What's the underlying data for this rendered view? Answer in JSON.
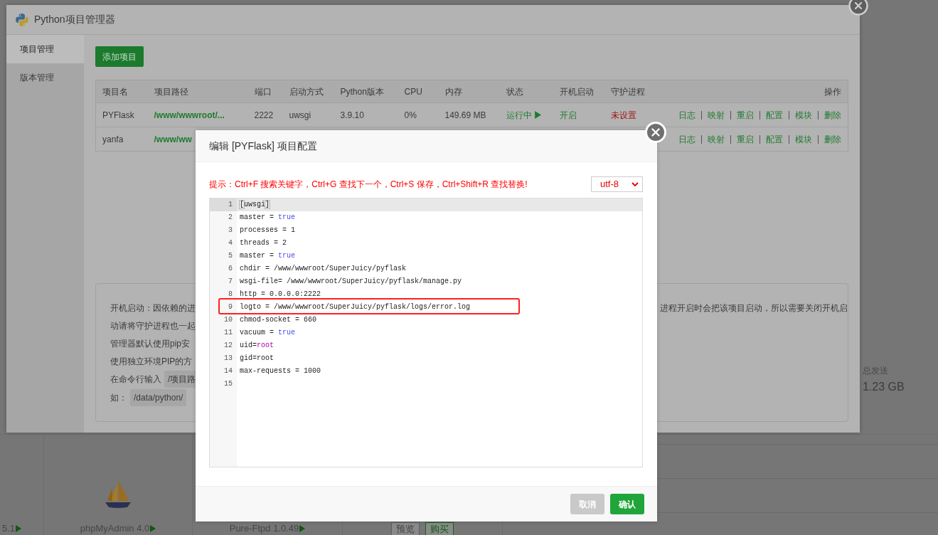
{
  "background_page": {
    "stats": {
      "label": "总发送",
      "value": "1.23 GB"
    },
    "tiles": [
      {
        "kind": "label",
        "label": "5.1"
      },
      {
        "kind": "logo",
        "label": "phpMyAdmin 4.0"
      },
      {
        "kind": "label",
        "label": "Pure-Ftpd 1.0.49"
      },
      {
        "kind": "buttons",
        "buttons": [
          {
            "label": "预览",
            "kind": "preview"
          },
          {
            "label": "购买",
            "kind": "buy"
          }
        ]
      }
    ]
  },
  "manager_window": {
    "title": "Python项目管理器",
    "sidebar": [
      {
        "label": "项目管理",
        "selected": true
      },
      {
        "label": "版本管理",
        "selected": false
      }
    ],
    "add_button": "添加项目",
    "table": {
      "columns": [
        "项目名",
        "项目路径",
        "端口",
        "启动方式",
        "Python版本",
        "CPU",
        "内存",
        "状态",
        "开机启动",
        "守护进程",
        "操作"
      ],
      "rows": [
        {
          "name": "PYFlask",
          "path": "/www/wwwroot/...",
          "port": "2222",
          "start_mode": "uwsgi",
          "python_version": "3.9.10",
          "cpu": "0%",
          "memory": "149.69 MB",
          "status": {
            "text": "运行中",
            "running": true
          },
          "autostart": {
            "text": "开启",
            "on": true
          },
          "daemon": {
            "text": "未设置",
            "configured": false
          },
          "actions": [
            "日志",
            "映射",
            "重启",
            "配置",
            "模块",
            "删除"
          ]
        },
        {
          "name": "yanfa",
          "path": "/www/ww",
          "actions": [
            "日志",
            "映射",
            "重启",
            "配置",
            "模块",
            "删除"
          ]
        }
      ]
    },
    "notes": [
      {
        "left": "开机启动：因依赖的进",
        "right": "进程开启时会把该项目启动，所以需要关闭开机启"
      },
      {
        "left": "动请将守护进程也一起"
      },
      {
        "left": "管理器默认使用pip安"
      },
      {
        "left": "使用独立环境PIP的方"
      },
      {
        "left": "在命令行输入",
        "code": "/项目路"
      },
      {
        "left": "如：",
        "code": "/data/python/"
      }
    ]
  },
  "editor_dialog": {
    "title": "编辑 [PYFlask] 项目配置",
    "hint": "提示：Ctrl+F 搜索关键字，Ctrl+G 查找下一个，Ctrl+S 保存，Ctrl+Shift+R 查找替换!",
    "encoding": "utf-8",
    "lines": [
      {
        "number": "1",
        "active": true,
        "annotated": false,
        "segments": [
          {
            "text": "[",
            "kind": "matched-bracket"
          },
          {
            "text": "uwsgi",
            "kind": "plain"
          },
          {
            "text": "]",
            "kind": "matched-bracket"
          }
        ]
      },
      {
        "number": "2",
        "active": false,
        "annotated": false,
        "segments": [
          {
            "text": "master = ",
            "kind": "plain"
          },
          {
            "text": "true",
            "kind": "atom"
          }
        ]
      },
      {
        "number": "3",
        "active": false,
        "annotated": false,
        "segments": [
          {
            "text": "processes = 1",
            "kind": "plain"
          }
        ]
      },
      {
        "number": "4",
        "active": false,
        "annotated": false,
        "segments": [
          {
            "text": "threads = 2",
            "kind": "plain"
          }
        ]
      },
      {
        "number": "5",
        "active": false,
        "annotated": false,
        "segments": [
          {
            "text": "master = ",
            "kind": "plain"
          },
          {
            "text": "true",
            "kind": "atom"
          }
        ]
      },
      {
        "number": "6",
        "active": false,
        "annotated": false,
        "segments": [
          {
            "text": "chdir = /www/wwwroot/SuperJuicy/pyflask",
            "kind": "plain"
          }
        ]
      },
      {
        "number": "7",
        "active": false,
        "annotated": false,
        "segments": [
          {
            "text": "wsgi-file= /www/wwwroot/SuperJuicy/pyflask/manage.py",
            "kind": "plain"
          }
        ]
      },
      {
        "number": "8",
        "active": false,
        "annotated": false,
        "segments": [
          {
            "text": "http = 0.0.0.0:2222",
            "kind": "plain"
          }
        ]
      },
      {
        "number": "9",
        "active": false,
        "annotated": true,
        "segments": [
          {
            "text": "logto = /www/wwwroot/SuperJuicy/pyflask/logs/error.log",
            "kind": "plain"
          }
        ]
      },
      {
        "number": "10",
        "active": false,
        "annotated": false,
        "segments": [
          {
            "text": "chmod-socket = 660",
            "kind": "plain"
          }
        ]
      },
      {
        "number": "11",
        "active": false,
        "annotated": false,
        "segments": [
          {
            "text": "vacuum = ",
            "kind": "plain"
          },
          {
            "text": "true",
            "kind": "atom"
          }
        ]
      },
      {
        "number": "12",
        "active": false,
        "annotated": false,
        "segments": [
          {
            "text": "uid=",
            "kind": "plain"
          },
          {
            "text": "root",
            "kind": "variable"
          }
        ]
      },
      {
        "number": "13",
        "active": false,
        "annotated": false,
        "segments": [
          {
            "text": "gid=root",
            "kind": "plain"
          }
        ]
      },
      {
        "number": "14",
        "active": false,
        "annotated": false,
        "segments": [
          {
            "text": "max-requests = 1000",
            "kind": "plain"
          }
        ]
      },
      {
        "number": "15",
        "active": false,
        "annotated": false
      }
    ],
    "buttons": [
      {
        "label": "取消",
        "kind": "cancel"
      },
      {
        "label": "确认",
        "kind": "confirm"
      }
    ]
  }
}
